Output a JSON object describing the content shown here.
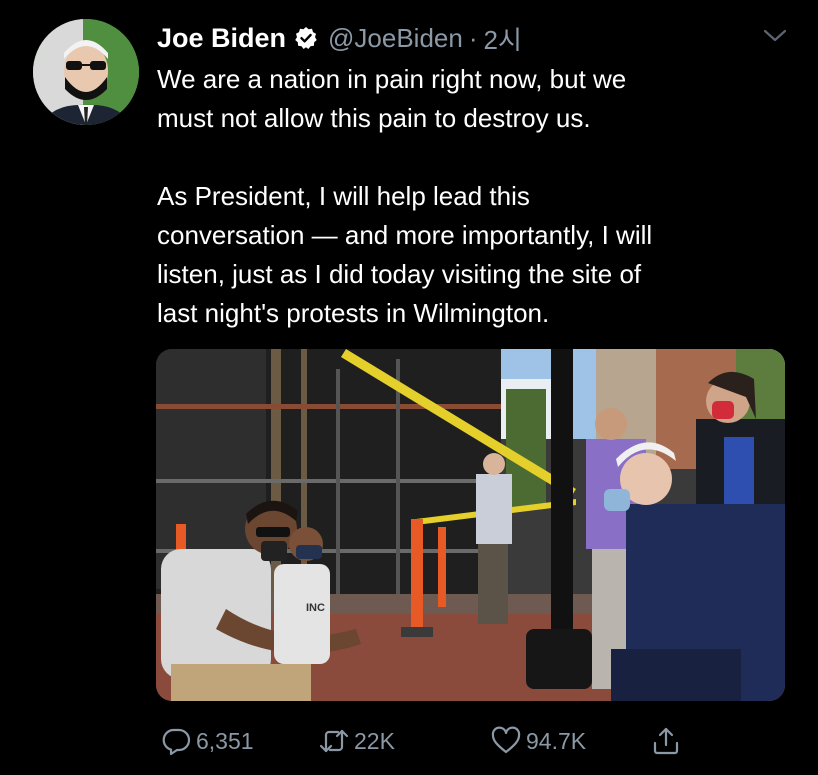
{
  "author": {
    "name": "Joe Biden",
    "handle": "@JoeBiden",
    "separator": "·",
    "time": "2시"
  },
  "tweet": {
    "paragraphs": [
      "We are a nation in pain right now, but we\nmust not allow this pain to destroy us.",
      "As President, I will help lead this\nconversation — and more importantly, I will\nlisten, just as I did today visiting the site of\nlast night's protests in Wilmington."
    ]
  },
  "media": {
    "shirt_text": "INC"
  },
  "actions": {
    "replies": "6,351",
    "retweets": "22K",
    "likes": "94.7K"
  },
  "colors": {
    "background": "#000000",
    "text": "#ffffff",
    "secondary": "#8b98a5"
  },
  "icons": [
    "verified-badge-icon",
    "chevron-down-icon",
    "reply-icon",
    "retweet-icon",
    "like-icon",
    "share-icon"
  ]
}
